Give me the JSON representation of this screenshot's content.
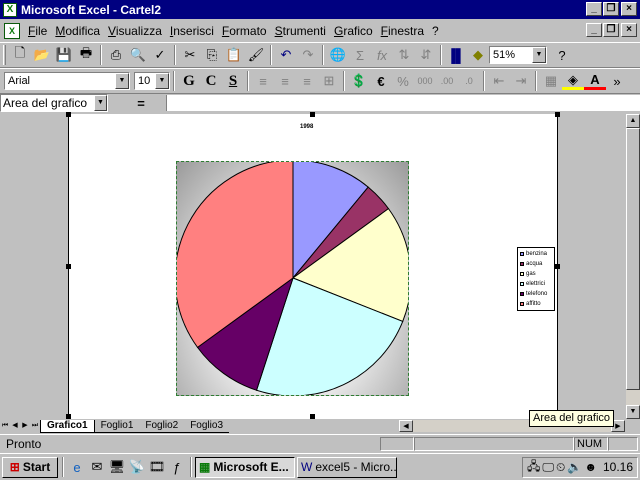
{
  "window": {
    "title": "Microsoft Excel - Cartel2"
  },
  "menu": [
    "File",
    "Modifica",
    "Visualizza",
    "Inserisci",
    "Formato",
    "Strumenti",
    "Grafico",
    "Finestra",
    "?"
  ],
  "toolbar": {
    "zoom": "51%"
  },
  "format": {
    "font": "Arial",
    "size": "10",
    "bold": "G",
    "italic": "C",
    "underline": "S"
  },
  "formula_bar": {
    "name_box": "Area del grafico",
    "equals": "="
  },
  "chart_data": {
    "type": "pie",
    "title": "1998",
    "slices": [
      {
        "label": "benzina",
        "value": 11,
        "color": "#9999ff"
      },
      {
        "label": "acqua",
        "value": 4,
        "color": "#993366"
      },
      {
        "label": "gas",
        "value": 16,
        "color": "#ffffcc"
      },
      {
        "label": "elettricità",
        "value": 24,
        "color": "#ccffff"
      },
      {
        "label": "telefono",
        "value": 10,
        "color": "#660066"
      },
      {
        "label": "affitto",
        "value": 35,
        "color": "#ff8080"
      }
    ],
    "legend": [
      "benzina",
      "acqua",
      "gas",
      "elettrici",
      "telefono",
      "affitto"
    ],
    "legend_position": "right"
  },
  "tooltip": "Area del grafico",
  "sheets": [
    "Grafico1",
    "Foglio1",
    "Foglio2",
    "Foglio3"
  ],
  "status": {
    "text": "Pronto",
    "num": "NUM"
  },
  "taskbar": {
    "start": "Start",
    "tasks": [
      "Microsoft E...",
      "excel5 - Micro..."
    ],
    "clock": "10.16"
  }
}
